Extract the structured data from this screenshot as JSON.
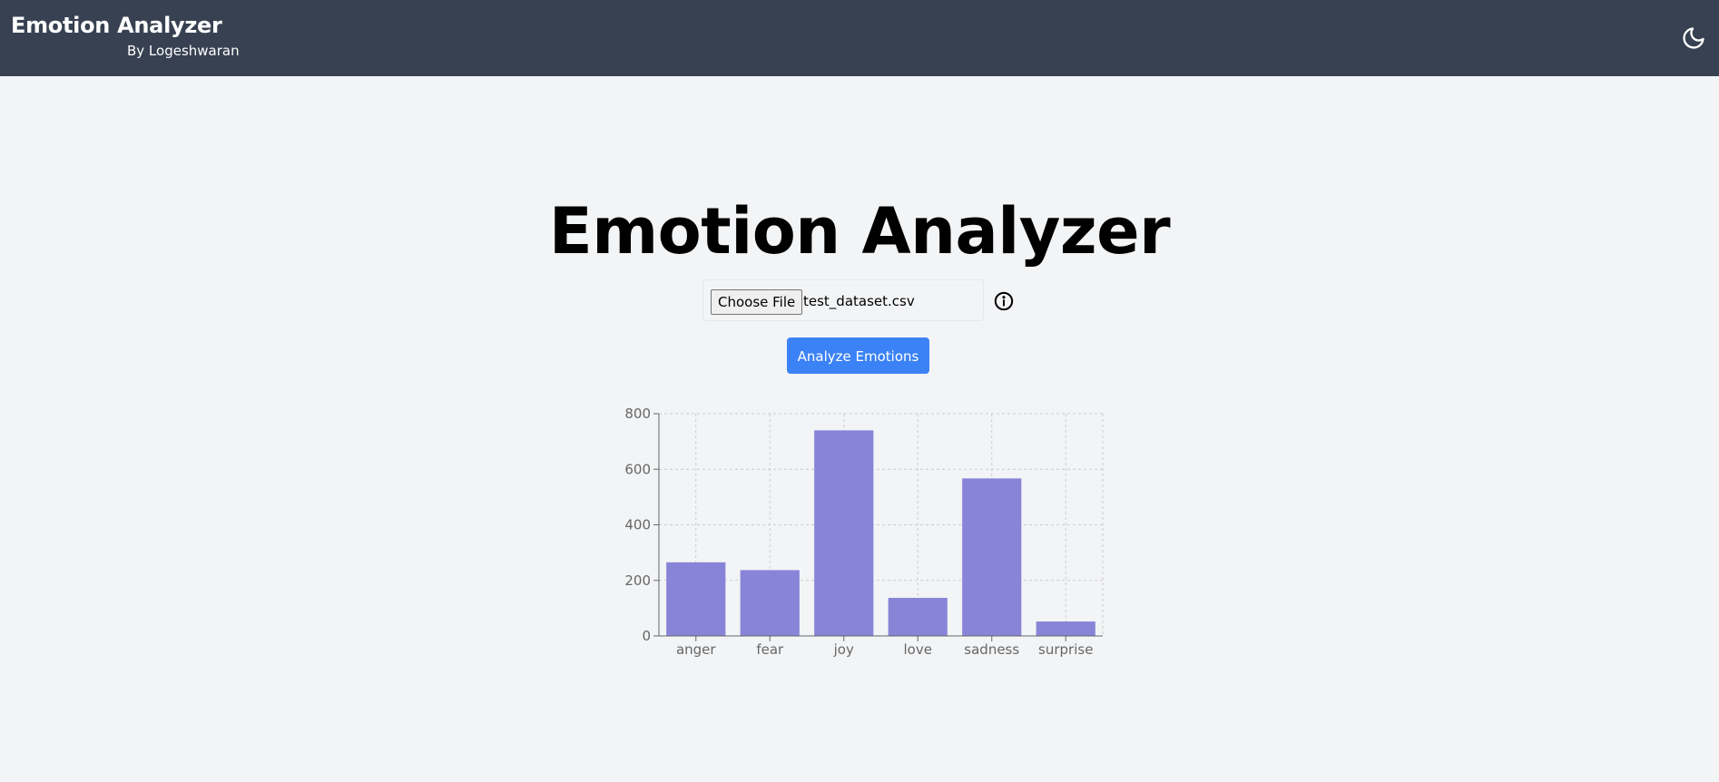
{
  "header": {
    "title": "Emotion Analyzer",
    "subtitle": "By Logeshwaran",
    "theme_toggle_icon": "moon-icon"
  },
  "main": {
    "title": "Emotion Analyzer",
    "file_input": {
      "button_label": "Choose File",
      "file_name": "test_dataset.csv"
    },
    "info_icon": "info-icon",
    "analyze_button": "Analyze Emotions"
  },
  "colors": {
    "navbar": "#374151",
    "background": "#f3f4f6",
    "accent": "#3b82f6",
    "bar": "#8884d8"
  },
  "chart_data": {
    "type": "bar",
    "categories": [
      "anger",
      "fear",
      "joy",
      "love",
      "sadness",
      "surprise"
    ],
    "values": [
      265,
      237,
      740,
      137,
      567,
      52
    ],
    "yticks": [
      0,
      200,
      400,
      600,
      800
    ],
    "ylim": [
      0,
      800
    ],
    "grid": true,
    "color": "#8884d8",
    "title": "",
    "xlabel": "",
    "ylabel": ""
  }
}
